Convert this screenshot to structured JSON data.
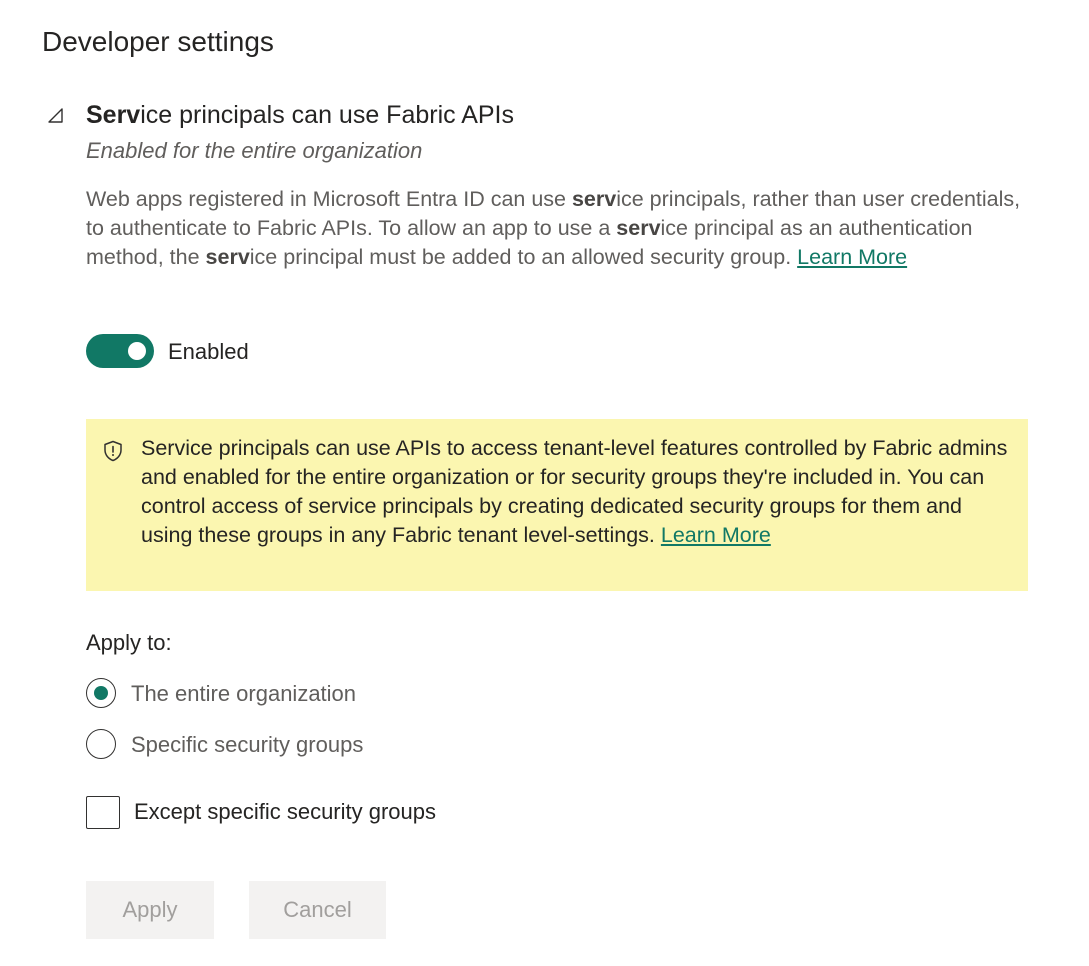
{
  "page": {
    "title": "Developer settings"
  },
  "setting": {
    "title_bold": "Serv",
    "title_rest": "ice principals can use Fabric APIs",
    "status": "Enabled for the entire organization",
    "collapse_icon": "collapse-triangle-icon",
    "description": {
      "p1": "Web apps registered in Microsoft Entra ID can use ",
      "b1": "serv",
      "p2": "ice principals, rather than user credentials, to authenticate to Fabric APIs. To allow an app to use a ",
      "b2": "serv",
      "p3": "ice principal as an authentication method, the ",
      "b3": "serv",
      "p4": "ice principal must be added to an allowed security group. ",
      "link": "Learn More"
    },
    "toggle": {
      "state": "on",
      "label": "Enabled"
    },
    "warning": {
      "icon": "shield-icon",
      "text": "Service principals can use APIs to access tenant-level features controlled by Fabric admins and enabled for the entire organization or for security groups they're included in. You can control access of service principals by creating dedicated security groups for them and using these groups in any Fabric tenant level-settings. ",
      "link": "Learn More"
    },
    "apply_to": {
      "label": "Apply to:",
      "options": [
        {
          "label": "The entire organization",
          "selected": true
        },
        {
          "label": "Specific security groups",
          "selected": false
        }
      ],
      "except_label": "Except specific security groups",
      "except_checked": false
    },
    "buttons": {
      "apply": "Apply",
      "cancel": "Cancel"
    }
  },
  "colors": {
    "accent": "#117865",
    "warning_bg": "#fbf6b0",
    "disabled_btn_bg": "#f3f2f1",
    "disabled_btn_text": "#a19f9d"
  }
}
